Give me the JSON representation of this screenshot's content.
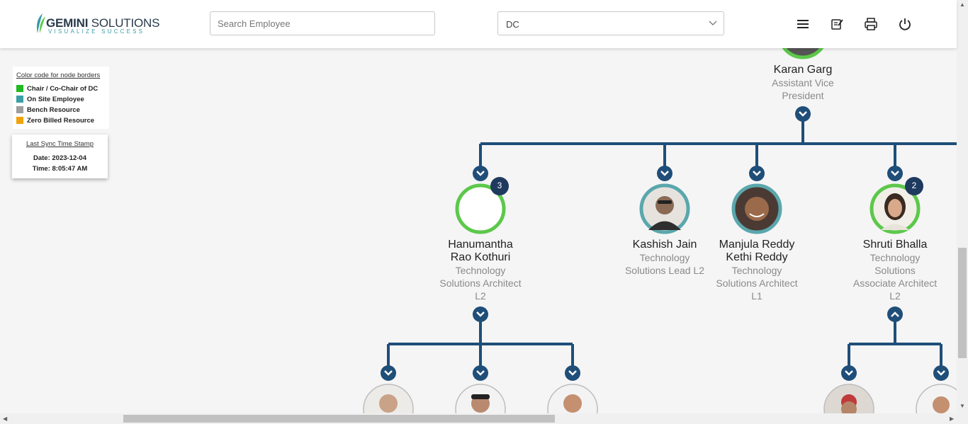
{
  "header": {
    "logo_brand_bold": "GEMINI",
    "logo_brand_rest": " SOLUTIONS",
    "logo_tagline": "VISUALIZE SUCCESS",
    "search_placeholder": "Search Employee",
    "dc_selected": "DC",
    "icons": [
      "menu-icon",
      "notes-icon",
      "print-icon",
      "power-icon"
    ]
  },
  "legend": {
    "title": "Color code for node borders",
    "items": [
      {
        "label": "Chair / Co-Chair of DC",
        "color": "#22b822"
      },
      {
        "label": "On Site Employee",
        "color": "#3aa0a6"
      },
      {
        "label": "Bench Resource",
        "color": "#9e9e9e"
      },
      {
        "label": "Zero Billed Resource",
        "color": "#f0a30a"
      }
    ]
  },
  "sync": {
    "title": "Last Sync Time Stamp",
    "date": "Date: 2023-12-04",
    "time": "Time: 8:05:47 AM"
  },
  "colors": {
    "connector": "#1f4e79",
    "green_border": "#5cc84a",
    "teal_border": "#5aa7ad",
    "badge": "#1f3a5f"
  },
  "org": {
    "root": {
      "name": "Karan Garg",
      "title_lines": [
        "Assistant Vice",
        "President"
      ]
    },
    "children": [
      {
        "name_lines": [
          "Hanumantha",
          "Rao Kothuri"
        ],
        "title_lines": [
          "Technology",
          "Solutions Architect",
          "L2"
        ],
        "badge": "3"
      },
      {
        "name_lines": [
          "Kashish Jain"
        ],
        "title_lines": [
          "Technology",
          "Solutions Lead L2"
        ]
      },
      {
        "name_lines": [
          "Manjula Reddy",
          "Kethi Reddy"
        ],
        "title_lines": [
          "Technology",
          "Solutions Architect",
          "L1"
        ]
      },
      {
        "name_lines": [
          "Shruti Bhalla"
        ],
        "title_lines": [
          "Technology",
          "Solutions",
          "Associate Architect",
          "L2"
        ],
        "badge": "2"
      }
    ]
  }
}
